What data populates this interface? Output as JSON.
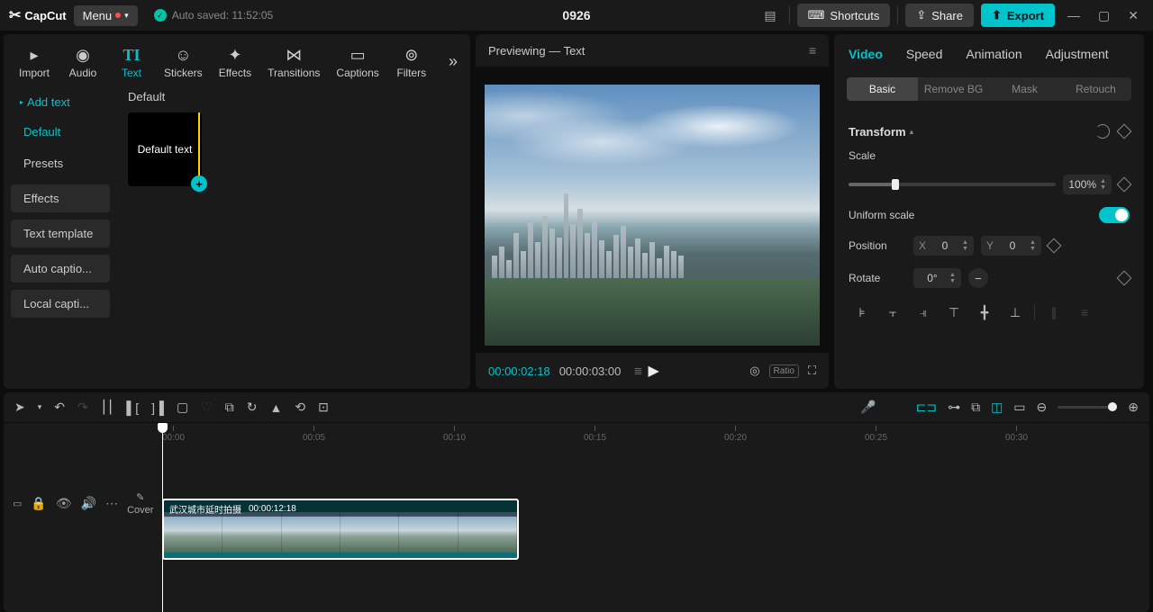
{
  "topbar": {
    "logo": "CapCut",
    "menu": "Menu",
    "autosave": "Auto saved: 11:52:05",
    "project": "0926",
    "shortcuts": "Shortcuts",
    "share": "Share",
    "export": "Export"
  },
  "left": {
    "tabs": [
      "Import",
      "Audio",
      "Text",
      "Stickers",
      "Effects",
      "Transitions",
      "Captions",
      "Filters"
    ],
    "active_tab": 2,
    "side_btn": "Add text",
    "side_items": [
      "Default",
      "Presets"
    ],
    "side_chips": [
      "Effects",
      "Text template",
      "Auto captio...",
      "Local capti..."
    ],
    "group_title": "Default",
    "thumb_label": "Default text"
  },
  "preview": {
    "title": "Previewing — Text",
    "tc_current": "00:00:02:18",
    "tc_total": "00:00:03:00",
    "ratio_label": "Ratio"
  },
  "right": {
    "tabs": [
      "Video",
      "Speed",
      "Animation",
      "Adjustment"
    ],
    "subtabs": [
      "Basic",
      "Remove BG",
      "Mask",
      "Retouch"
    ],
    "transform": "Transform",
    "scale_label": "Scale",
    "scale_value": "100%",
    "uniform_label": "Uniform scale",
    "position_label": "Position",
    "x_label": "X",
    "x_value": "0",
    "y_label": "Y",
    "y_value": "0",
    "rotate_label": "Rotate",
    "rotate_value": "0°"
  },
  "timeline": {
    "ticks": [
      "00:00",
      "00:05",
      "00:10",
      "00:15",
      "00:20",
      "00:25",
      "00:30"
    ],
    "cover": "Cover",
    "clip_name": "武汉城市延时拍摄",
    "clip_dur": "00:00:12:18"
  }
}
